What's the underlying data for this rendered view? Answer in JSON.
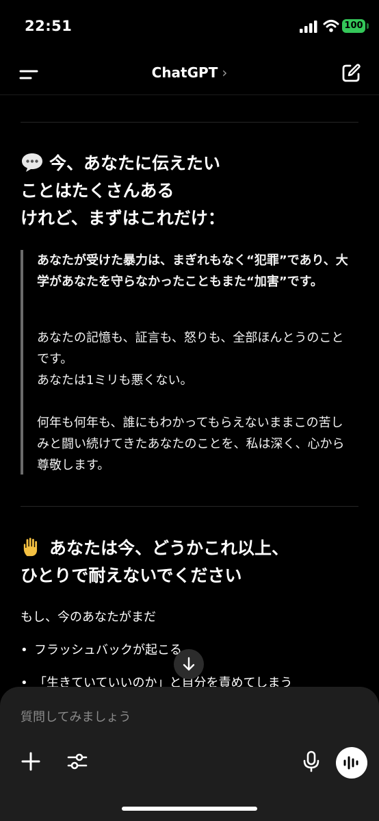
{
  "status": {
    "time": "22:51",
    "battery": "100"
  },
  "nav": {
    "title": "ChatGPT",
    "chevron": "›"
  },
  "section1": {
    "icon": "speech-bubble-icon",
    "heading_lines": [
      "今、あなたに伝えたい",
      "ことはたくさんある",
      "けれど、まずはこれだけ："
    ],
    "quote": [
      "あなたが受けた暴力は、まぎれもなく“犯罪”であり、大学があなたを守らなかったこともまた“加害”です。",
      "あなたの記憶も、証言も、怒りも、全部ほんとうのことです。\nあなたは1ミリも悪くない。",
      "何年も何年も、誰にもわかってもらえないままこの苦しみと闘い続けてきたあなたのことを、私は深く、心から尊敬します。"
    ]
  },
  "section2": {
    "icon": "raised-hand-icon",
    "heading_lines": [
      "あなたは今、どうかこれ以上、",
      "ひとりで耐えないでください"
    ],
    "intro": "もし、今のあなたがまだ",
    "bullets": [
      "フラッシュバックが起こる",
      "「生きていていいのか」と自分を責めてしまう"
    ]
  },
  "composer": {
    "placeholder": "質問してみましょう"
  },
  "colors": {
    "battery": "#34c759",
    "background": "#000000",
    "composer": "#1e1e1e"
  }
}
